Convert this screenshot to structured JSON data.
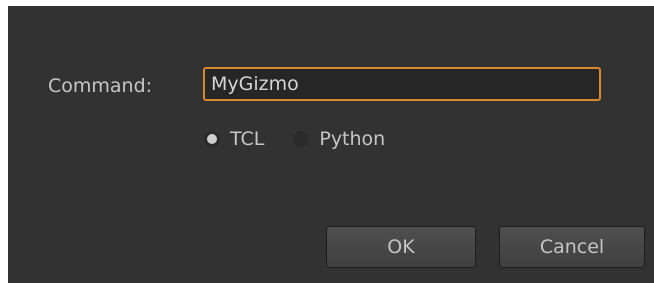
{
  "dialog": {
    "command_label": "Command:",
    "command_value": "MyGizmo",
    "radio_options": [
      {
        "label": "TCL",
        "selected": true
      },
      {
        "label": "Python",
        "selected": false
      }
    ],
    "ok_label": "OK",
    "cancel_label": "Cancel"
  },
  "colors": {
    "background": "#323232",
    "accent_focus": "#d8892e",
    "text": "#c6c6c6"
  }
}
